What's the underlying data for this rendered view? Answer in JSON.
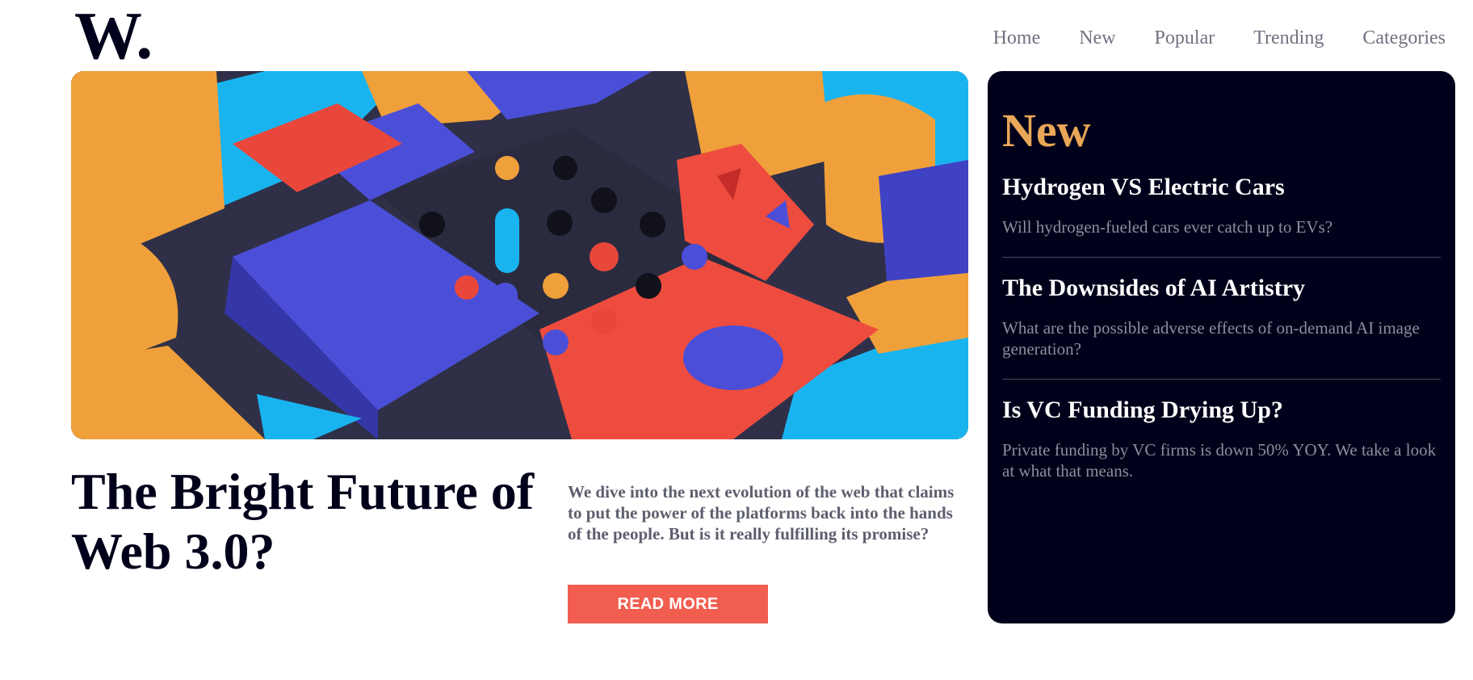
{
  "brand": {
    "logo_text": "W."
  },
  "nav": {
    "items": [
      {
        "label": "Home"
      },
      {
        "label": "New"
      },
      {
        "label": "Popular"
      },
      {
        "label": "Trending"
      },
      {
        "label": "Categories"
      }
    ]
  },
  "feature": {
    "headline": "The Bright Future of Web 3.0?",
    "summary": "We dive into the next evolution of the web that claims to put the power of the platforms back into the hands of the people. But is it really fulfilling its promise?",
    "cta_label": "READ MORE"
  },
  "sidebar": {
    "title": "New",
    "articles": [
      {
        "title": "Hydrogen VS Electric Cars",
        "description": "Will hydrogen-fueled cars ever catch up to EVs?"
      },
      {
        "title": "The Downsides of AI Artistry",
        "description": "What are the possible adverse effects of on-demand AI image generation?"
      },
      {
        "title": "Is VC Funding Drying Up?",
        "description": "Private funding by VC firms is down 50% YOY. We take a look at what that means."
      }
    ]
  },
  "colors": {
    "accent": "#f15e50",
    "dark": "#00001a",
    "sidebar_title": "#e9a758",
    "muted_text": "#5d5f6e",
    "nav_text": "#6f7280"
  }
}
